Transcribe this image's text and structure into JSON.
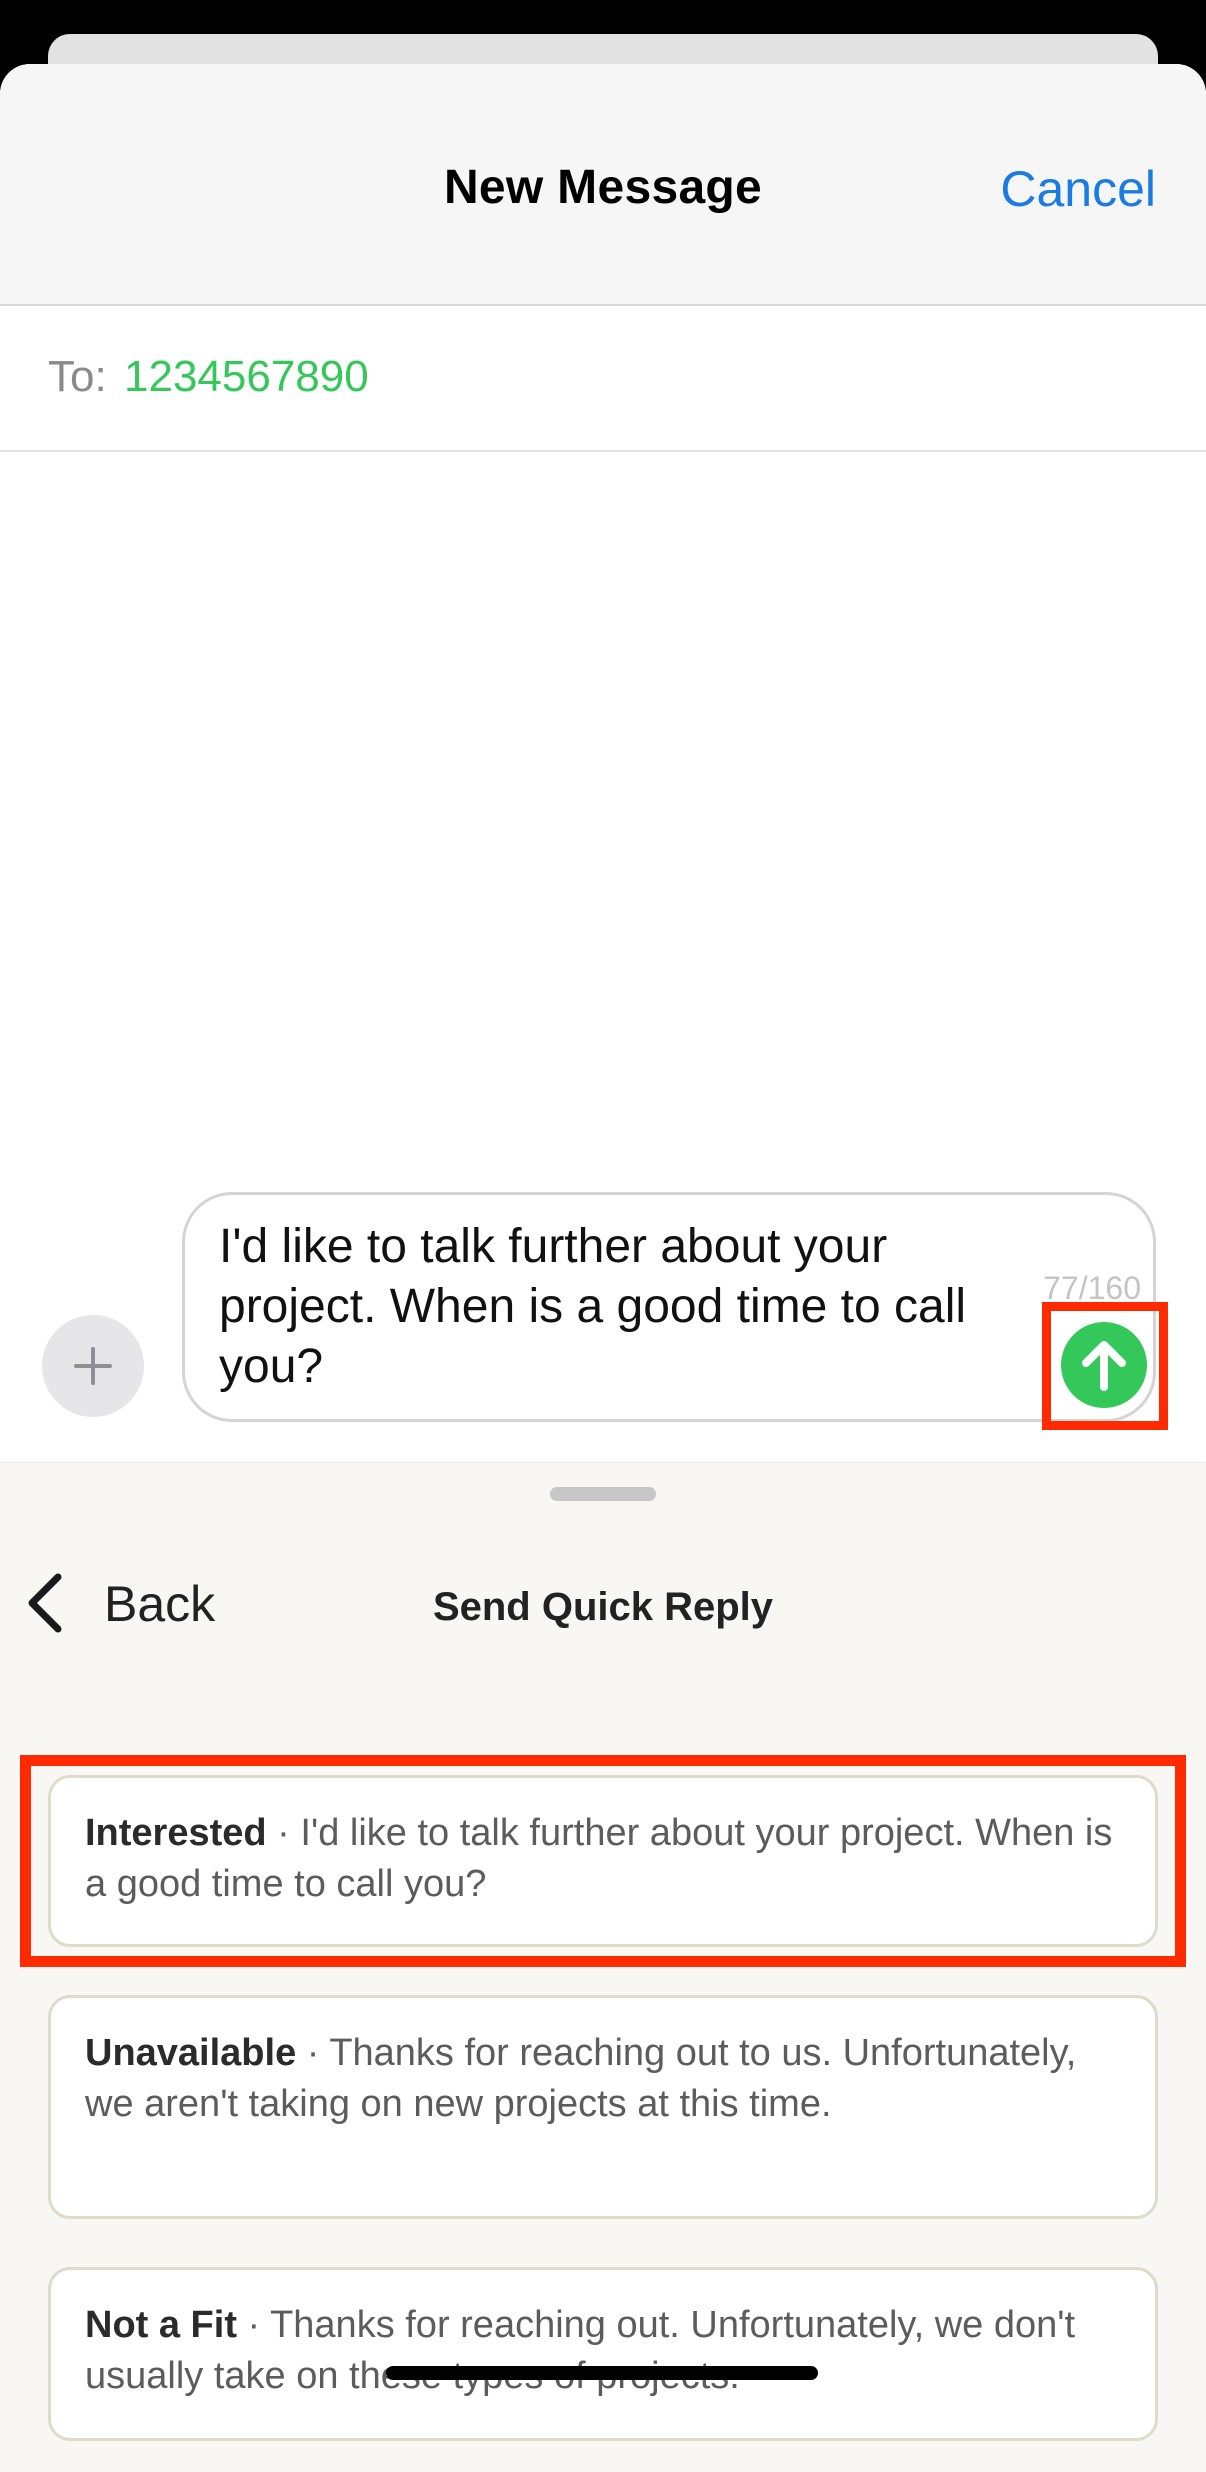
{
  "header": {
    "title": "New Message",
    "cancel_label": "Cancel"
  },
  "recipient": {
    "label": "To:",
    "value": "1234567890"
  },
  "composer": {
    "text_lines": [
      "I'd like to talk further about your",
      "project. When is a good time to call",
      "you?"
    ],
    "char_count": "77/160"
  },
  "quick_reply": {
    "back_label": "Back",
    "title": "Send Quick Reply",
    "options": [
      {
        "label": "Interested",
        "separator": " · ",
        "text": "I'd like to talk further about your project. When is a good time to call you?"
      },
      {
        "label": "Unavailable",
        "separator": " · ",
        "text": "Thanks for reaching out to us. Unfortunately, we aren't taking on new projects at this time."
      },
      {
        "label": "Not a Fit",
        "separator": " · ",
        "text": "Thanks for reaching out. Unfortunately, we don't usually take on these types of projects."
      }
    ]
  },
  "colors": {
    "accent_blue": "#1a7ce2",
    "green": "#34c759",
    "highlight": "#ff2a00"
  },
  "icons": {
    "plus": "plus-icon",
    "send": "arrow-up-icon",
    "back": "chevron-left-icon"
  }
}
